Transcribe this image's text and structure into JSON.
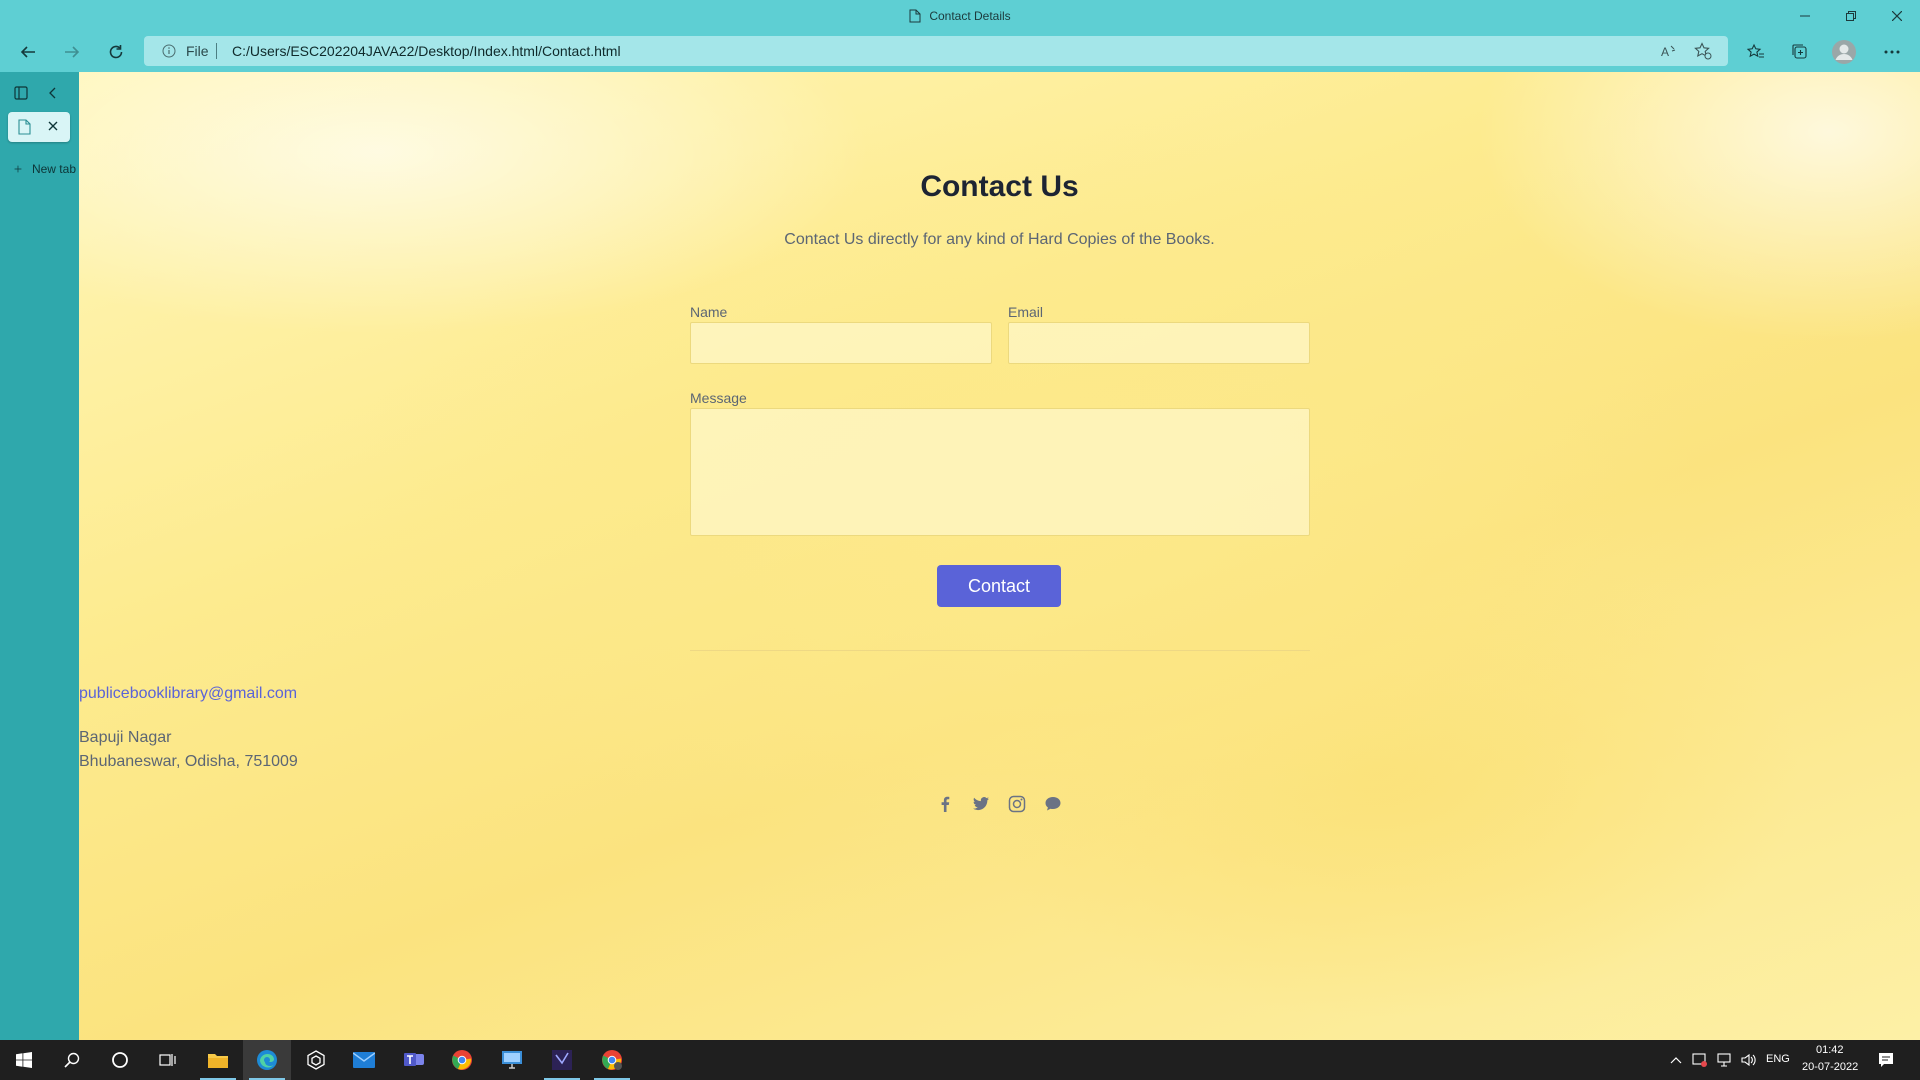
{
  "browser": {
    "window_title": "Contact Details",
    "address": {
      "scheme_label": "File",
      "url": "C:/Users/ESC202204JAVA22/Desktop/Index.html/Contact.html"
    },
    "sidebar": {
      "new_tab_label": "New tab"
    }
  },
  "page": {
    "heading": "Contact Us",
    "subtitle": "Contact Us directly for any kind of Hard Copies of the Books.",
    "form": {
      "name_label": "Name",
      "email_label": "Email",
      "message_label": "Message",
      "name_value": "",
      "email_value": "",
      "message_value": "",
      "submit_label": "Contact"
    },
    "footer": {
      "email": "publicebooklibrary@gmail.com",
      "address_line1": "Bapuji Nagar",
      "address_line2": "Bhubaneswar, Odisha, 751009",
      "social_icons": [
        "facebook-icon",
        "twitter-icon",
        "instagram-icon",
        "chat-icon"
      ]
    }
  },
  "taskbar": {
    "language": "ENG",
    "time": "01:42",
    "date": "20-07-2022",
    "pinned": [
      "start-icon",
      "search-icon",
      "cortana-icon",
      "task-view-icon",
      "file-explorer-icon",
      "edge-icon",
      "app-icon",
      "mail-icon",
      "teams-icon",
      "chrome-icon",
      "remote-desktop-icon",
      "ide-icon",
      "chrome-profile-icon"
    ]
  },
  "colors": {
    "chrome_teal": "#5ecfd3",
    "sidebar_teal": "#2fa8ac",
    "page_yellow": "#fdeb8f",
    "accent_button": "#5a63d8",
    "link_color": "#5a63d8",
    "taskbar": "#1f1f1f"
  }
}
